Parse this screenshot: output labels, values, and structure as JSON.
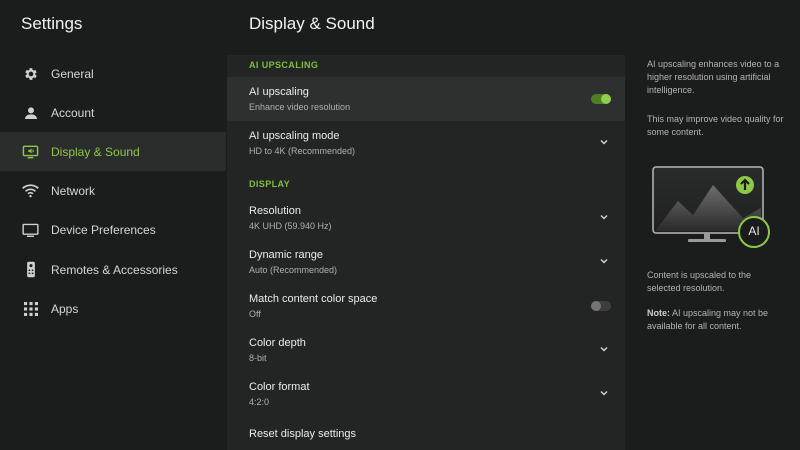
{
  "sidebar": {
    "title": "Settings",
    "items": [
      {
        "label": "General",
        "icon": "gear-icon"
      },
      {
        "label": "Account",
        "icon": "person-icon"
      },
      {
        "label": "Display & Sound",
        "icon": "display-sound-icon"
      },
      {
        "label": "Network",
        "icon": "wifi-icon"
      },
      {
        "label": "Device Preferences",
        "icon": "monitor-icon"
      },
      {
        "label": "Remotes & Accessories",
        "icon": "remote-icon"
      },
      {
        "label": "Apps",
        "icon": "apps-grid-icon"
      }
    ]
  },
  "main": {
    "title": "Display & Sound",
    "sections": {
      "ai": "AI UPSCALING",
      "display": "DISPLAY"
    },
    "rows": {
      "ai_upscaling": {
        "title": "AI upscaling",
        "subtitle": "Enhance video resolution",
        "on": true
      },
      "ai_mode": {
        "title": "AI upscaling mode",
        "subtitle": "HD to 4K (Recommended)"
      },
      "resolution": {
        "title": "Resolution",
        "subtitle": "4K UHD (59.940 Hz)"
      },
      "dynamic_range": {
        "title": "Dynamic range",
        "subtitle": "Auto (Recommended)"
      },
      "match_color": {
        "title": "Match content color space",
        "subtitle": "Off",
        "on": false
      },
      "color_depth": {
        "title": "Color depth",
        "subtitle": "8-bit"
      },
      "color_format": {
        "title": "Color format",
        "subtitle": "4:2:0"
      },
      "reset": {
        "title": "Reset display settings"
      }
    }
  },
  "info": {
    "p1": "AI upscaling enhances video to a higher resolution using artificial intelligence.",
    "p2": "This may improve video quality for some content.",
    "badge": "AI",
    "p3": "Content is upscaled to the selected resolution.",
    "note_label": "Note:",
    "note_text": " AI upscaling may not be available for all content."
  },
  "colors": {
    "accent": "#8fc748",
    "background": "#1b1c1c",
    "panel": "#232424"
  }
}
